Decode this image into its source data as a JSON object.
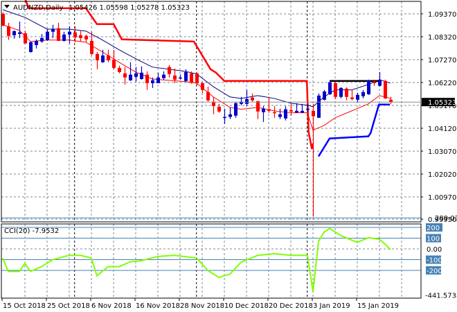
{
  "header": {
    "symbol": "AUDNZD,Daily",
    "ohlc": "1.05426 1.05598 1.05278 1.05323",
    "menu_icon": "triangle-down-icon"
  },
  "price_axis": {
    "ticks": [
      "1.09370",
      "1.08320",
      "1.07270",
      "1.06220",
      "1.05170",
      "1.04120",
      "1.03070",
      "1.02020",
      "1.00970",
      "0.99950"
    ],
    "tick_values": [
      1.0937,
      1.0832,
      1.0727,
      1.0622,
      1.0517,
      1.0412,
      1.0307,
      1.0202,
      1.0097,
      0.9995
    ],
    "current_price": "1.05323",
    "current_value": 1.05323
  },
  "time_axis": {
    "labels": [
      "15 Oct 2018",
      "25 Oct 2018",
      "6 Nov 2018",
      "16 Nov 2018",
      "28 Nov 2018",
      "10 Dec 2018",
      "20 Dec 2018",
      "3 Jan 2019",
      "15 Jan 2019"
    ],
    "label_bar_index": [
      0,
      8,
      16,
      24,
      32,
      40,
      48,
      56,
      64
    ],
    "period_separators_bar_index": [
      12.9,
      34.9,
      54.9
    ]
  },
  "colors": {
    "bull": "#0000c8",
    "bear": "#ff0000",
    "ma_fast": "#ff0000",
    "ma_slow": "#000080",
    "upper_channel": "#ff0000",
    "lower_channel": "#0000ff",
    "cci": "#7fff00",
    "cci_levels": "#4682b4",
    "grid": "#778899"
  },
  "chart_data": {
    "type": "candlestick",
    "title": "AUDNZD,Daily",
    "ylim": [
      0.9975,
      1.1001
    ],
    "candles_ohlc": [
      [
        1.0937,
        1.0944,
        1.088,
        1.0883
      ],
      [
        1.088,
        1.0896,
        1.0817,
        1.0836
      ],
      [
        1.0839,
        1.0861,
        1.0823,
        1.0858
      ],
      [
        1.0845,
        1.0902,
        1.0826,
        1.0852
      ],
      [
        1.0848,
        1.0858,
        1.0801,
        1.0801
      ],
      [
        1.0762,
        1.081,
        1.0759,
        1.0807
      ],
      [
        1.0794,
        1.082,
        1.0778,
        1.0813
      ],
      [
        1.081,
        1.0845,
        1.0804,
        1.0826
      ],
      [
        1.0817,
        1.0867,
        1.0813,
        1.0855
      ],
      [
        1.0855,
        1.0887,
        1.0826,
        1.0867
      ],
      [
        1.0871,
        1.0896,
        1.0813,
        1.0813
      ],
      [
        1.0813,
        1.0855,
        1.081,
        1.0842
      ],
      [
        1.0842,
        1.088,
        1.0801,
        1.0855
      ],
      [
        1.0852,
        1.088,
        1.0807,
        1.0829
      ],
      [
        1.0839,
        1.0858,
        1.081,
        1.0826
      ],
      [
        1.0836,
        1.0842,
        1.0807,
        1.082
      ],
      [
        1.0813,
        1.0855,
        1.0746,
        1.0753
      ],
      [
        1.0753,
        1.0762,
        1.0683,
        1.0724
      ],
      [
        1.0715,
        1.0772,
        1.0712,
        1.0746
      ],
      [
        1.0746,
        1.0772,
        1.0715,
        1.0724
      ],
      [
        1.0727,
        1.0772,
        1.0683,
        1.0689
      ],
      [
        1.0689,
        1.0699,
        1.0664,
        1.067
      ],
      [
        1.0664,
        1.0693,
        1.0613,
        1.0645
      ],
      [
        1.0632,
        1.0715,
        1.0629,
        1.0658
      ],
      [
        1.0648,
        1.0693,
        1.0626,
        1.0664
      ],
      [
        1.0638,
        1.0696,
        1.0635,
        1.0667
      ],
      [
        1.0658,
        1.0673,
        1.0588,
        1.0619
      ],
      [
        1.0619,
        1.0645,
        1.0597,
        1.0632
      ],
      [
        1.0619,
        1.0667,
        1.0619,
        1.0645
      ],
      [
        1.0642,
        1.0673,
        1.0635,
        1.0658
      ],
      [
        1.0693,
        1.0702,
        1.0645,
        1.0661
      ],
      [
        1.0654,
        1.0686,
        1.0619,
        1.0635
      ],
      [
        1.0645,
        1.0658,
        1.0635,
        1.0645
      ],
      [
        1.0629,
        1.0683,
        1.0626,
        1.067
      ],
      [
        1.0664,
        1.0673,
        1.0616,
        1.0623
      ],
      [
        1.0664,
        1.0667,
        1.061,
        1.0619
      ],
      [
        1.0619,
        1.0623,
        1.0572,
        1.0588
      ],
      [
        1.0578,
        1.0603,
        1.0534,
        1.054
      ],
      [
        1.0534,
        1.0556,
        1.0476,
        1.0514
      ],
      [
        1.0511,
        1.0524,
        1.0483,
        1.0489
      ],
      [
        1.046,
        1.0502,
        1.0432,
        1.0464
      ],
      [
        1.0464,
        1.0508,
        1.0454,
        1.0476
      ],
      [
        1.047,
        1.0534,
        1.046,
        1.0527
      ],
      [
        1.0524,
        1.0556,
        1.0518,
        1.0534
      ],
      [
        1.0524,
        1.0588,
        1.0514,
        1.0546
      ],
      [
        1.0553,
        1.0572,
        1.0534,
        1.054
      ],
      [
        1.0537,
        1.0537,
        1.0454,
        1.0489
      ],
      [
        1.0486,
        1.0514,
        1.0441,
        1.0502
      ],
      [
        1.0499,
        1.0556,
        1.0483,
        1.0492
      ],
      [
        1.0486,
        1.0514,
        1.046,
        1.0483
      ],
      [
        1.0464,
        1.0502,
        1.0454,
        1.0476
      ],
      [
        1.0457,
        1.0514,
        1.0448,
        1.0499
      ],
      [
        1.0495,
        1.0524,
        1.047,
        1.0489
      ],
      [
        1.0483,
        1.0527,
        1.0483,
        1.0492
      ],
      [
        1.0483,
        1.0524,
        1.0483,
        1.0492
      ],
      [
        1.0499,
        1.0524,
        1.0486,
        1.0502
      ],
      [
        1.0492,
        1.0524,
        1.0006,
        1.0467
      ],
      [
        1.046,
        1.0572,
        1.046,
        1.0562
      ],
      [
        1.0543,
        1.0588,
        1.054,
        1.0581
      ],
      [
        1.0568,
        1.0632,
        1.0565,
        1.0623
      ],
      [
        1.0619,
        1.0626,
        1.0546,
        1.0556
      ],
      [
        1.0556,
        1.06,
        1.0549,
        1.0597
      ],
      [
        1.0594,
        1.06,
        1.054,
        1.0556
      ],
      [
        1.0553,
        1.0588,
        1.054,
        1.0546
      ],
      [
        1.0543,
        1.0575,
        1.053,
        1.0565
      ],
      [
        1.0559,
        1.0588,
        1.0549,
        1.0578
      ],
      [
        1.0568,
        1.0635,
        1.0565,
        1.0632
      ],
      [
        1.0626,
        1.0635,
        1.0607,
        1.0619
      ],
      [
        1.0607,
        1.067,
        1.0603,
        1.0635
      ],
      [
        1.0629,
        1.0635,
        1.0546,
        1.0549
      ],
      [
        1.0543,
        1.0556,
        1.0524,
        1.0532
      ]
    ],
    "ma_slow": [
      [
        0,
        1.0956
      ],
      [
        4,
        1.0921
      ],
      [
        8,
        1.0867
      ],
      [
        12,
        1.0867
      ],
      [
        15,
        1.0858
      ],
      [
        18,
        1.0817
      ],
      [
        21,
        1.0772
      ],
      [
        24,
        1.0731
      ],
      [
        27,
        1.0693
      ],
      [
        30,
        1.0683
      ],
      [
        33,
        1.0673
      ],
      [
        35,
        1.0661
      ],
      [
        38,
        1.0603
      ],
      [
        41,
        1.0556
      ],
      [
        43,
        1.0549
      ],
      [
        46,
        1.0562
      ],
      [
        49,
        1.0549
      ],
      [
        52,
        1.0527
      ],
      [
        55,
        1.0518
      ],
      [
        56,
        1.0511
      ],
      [
        58,
        1.0556
      ],
      [
        60,
        1.0588
      ],
      [
        63,
        1.0588
      ],
      [
        66,
        1.0613
      ],
      [
        68,
        1.0635
      ],
      [
        70,
        1.0619
      ]
    ],
    "ma_fast": [
      [
        0,
        1.0887
      ],
      [
        3,
        1.0861
      ],
      [
        5,
        1.081
      ],
      [
        8,
        1.0817
      ],
      [
        12,
        1.0817
      ],
      [
        15,
        1.0807
      ],
      [
        18,
        1.0762
      ],
      [
        21,
        1.0715
      ],
      [
        24,
        1.067
      ],
      [
        27,
        1.0638
      ],
      [
        30,
        1.0632
      ],
      [
        33,
        1.0626
      ],
      [
        35,
        1.0619
      ],
      [
        38,
        1.0556
      ],
      [
        41,
        1.0508
      ],
      [
        43,
        1.0499
      ],
      [
        46,
        1.0508
      ],
      [
        49,
        1.0492
      ],
      [
        52,
        1.0483
      ],
      [
        55,
        1.0483
      ],
      [
        56,
        1.0403
      ],
      [
        58,
        1.0425
      ],
      [
        60,
        1.046
      ],
      [
        63,
        1.0492
      ],
      [
        66,
        1.0524
      ],
      [
        68,
        1.0562
      ],
      [
        69,
        1.0556
      ],
      [
        70,
        1.0549
      ]
    ],
    "upper_channel": [
      [
        4.1,
        1.1001
      ],
      [
        4.7,
        1.0963
      ],
      [
        15,
        1.0963
      ],
      [
        17,
        1.089
      ],
      [
        20,
        1.089
      ],
      [
        21.5,
        1.082
      ],
      [
        34.5,
        1.081
      ],
      [
        37.5,
        1.0683
      ],
      [
        38.5,
        1.0667
      ],
      [
        40,
        1.0629
      ],
      [
        54.9,
        1.0629
      ],
      [
        55.2,
        1.0396
      ],
      [
        55.8,
        1.0317
      ],
      [
        56,
        1.0343
      ]
    ],
    "lower_channel": [
      [
        57,
        1.0283
      ],
      [
        59,
        1.0365
      ],
      [
        66,
        1.0375
      ],
      [
        66.4,
        1.039
      ],
      [
        67.9,
        1.0521
      ],
      [
        69.9,
        1.0521
      ]
    ],
    "resistance_line": [
      [
        59,
        1.0629
      ],
      [
        68,
        1.0629
      ]
    ]
  },
  "cci": {
    "label": "CCI(20) -7.9532",
    "value": -7.9532,
    "max_label": "289.0307",
    "min_label": "-441.5738",
    "levels": [
      "200",
      "100",
      "0.00",
      "-100",
      "-200"
    ],
    "level_values": [
      200,
      100,
      0,
      -100,
      -200
    ],
    "series": [
      [
        0,
        -85
      ],
      [
        1,
        -210
      ],
      [
        3,
        -210
      ],
      [
        4,
        -135
      ],
      [
        5,
        -210
      ],
      [
        7,
        -165
      ],
      [
        9,
        -100
      ],
      [
        12,
        -60
      ],
      [
        14,
        -60
      ],
      [
        16,
        -85
      ],
      [
        17,
        -250
      ],
      [
        19,
        -165
      ],
      [
        21,
        -165
      ],
      [
        23,
        -120
      ],
      [
        25,
        -110
      ],
      [
        28,
        -70
      ],
      [
        31,
        -60
      ],
      [
        35,
        -85
      ],
      [
        37,
        -200
      ],
      [
        39,
        -265
      ],
      [
        41,
        -235
      ],
      [
        43,
        -125
      ],
      [
        46,
        -60
      ],
      [
        49,
        -45
      ],
      [
        52,
        -60
      ],
      [
        55,
        -60
      ],
      [
        56,
        -400
      ],
      [
        57,
        70
      ],
      [
        58,
        155
      ],
      [
        59,
        190
      ],
      [
        61,
        125
      ],
      [
        64,
        60
      ],
      [
        66,
        105
      ],
      [
        68,
        90
      ],
      [
        69,
        45
      ],
      [
        70,
        -8
      ]
    ]
  }
}
